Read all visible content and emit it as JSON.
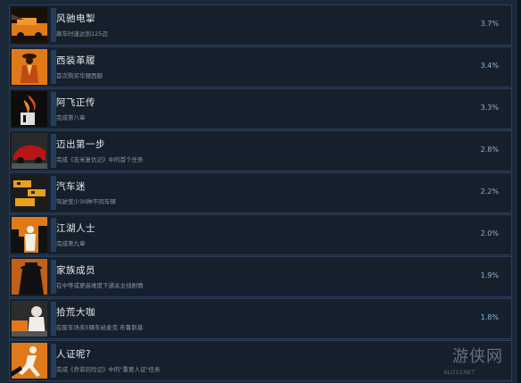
{
  "achievements": [
    {
      "title": "风驰电掣",
      "desc": "飙车时速达到125迈",
      "pct": "3.7%",
      "icon": "speeding-car-icon",
      "bar": 0.037
    },
    {
      "title": "西装革履",
      "desc": "首次购买华丽西服",
      "pct": "3.4%",
      "icon": "suit-man-icon",
      "bar": 0.034
    },
    {
      "title": "阿飞正传",
      "desc": "完成第八章",
      "pct": "3.3%",
      "icon": "flaming-hand-icon",
      "bar": 0.033
    },
    {
      "title": "迈出第一步",
      "desc": "完成《吉米复仇记》中的首个任务",
      "pct": "2.8%",
      "icon": "red-car-icon",
      "bar": 0.028
    },
    {
      "title": "汽车迷",
      "desc": "驾驶至少30种不同车辆",
      "pct": "2.2%",
      "icon": "taxi-cars-icon",
      "bar": 0.022
    },
    {
      "title": "江湖人士",
      "desc": "完成第九章",
      "pct": "2.0%",
      "icon": "city-gangster-icon",
      "bar": 0.02
    },
    {
      "title": "家族成员",
      "desc": "在中等或更高难度下通关主线剧情",
      "pct": "1.9%",
      "icon": "fedora-man-icon",
      "bar": 0.019
    },
    {
      "title": "拾荒大咖",
      "desc": "在废车场卖5辆车给麦克 布鲁斯基",
      "pct": "1.8%",
      "icon": "junkyard-man-icon",
      "bar": 0.018
    },
    {
      "title": "人证呢?",
      "desc": "完成《乔菲历险记》中的\"重要人证\"任务",
      "pct": "",
      "icon": "running-man-icon",
      "bar": 0.015
    }
  ],
  "watermark": {
    "text": "游侠网",
    "sub": "ALI213.NET"
  }
}
